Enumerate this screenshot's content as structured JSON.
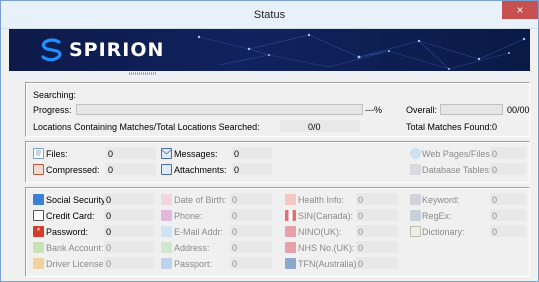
{
  "window": {
    "title": "Status",
    "close_glyph": "×"
  },
  "brand": {
    "name": "SPIRION"
  },
  "progress_panel": {
    "searching_label": "Searching:",
    "progress_label": "Progress:",
    "progress_suffix": "---%",
    "overall_label": "Overall:",
    "overall_value": "00/00",
    "locations_label": "Locations Containing Matches/Total Locations Searched:",
    "locations_value": "0/0",
    "total_matches_label": "Total Matches Found:",
    "total_matches_value": "0"
  },
  "counts_panel": {
    "files": {
      "label": "Files:",
      "value": "0",
      "icon": "file-icon"
    },
    "messages": {
      "label": "Messages:",
      "value": "0",
      "icon": "envelope-icon"
    },
    "web_pages": {
      "label": "Web Pages/Files:",
      "value": "0",
      "icon": "globe-icon"
    },
    "compressed": {
      "label": "Compressed:",
      "value": "0",
      "icon": "archive-icon"
    },
    "attachments": {
      "label": "Attachments:",
      "value": "0",
      "icon": "attachment-icon"
    },
    "database_tables": {
      "label": "Database Tables:",
      "value": "0",
      "icon": "database-icon"
    }
  },
  "types_panel": {
    "col1": [
      {
        "label": "Social Security:",
        "value": "0",
        "icon": "id-card-icon"
      },
      {
        "label": "Credit Card:",
        "value": "0",
        "icon": "credit-card-icon"
      },
      {
        "label": "Password:",
        "value": "0",
        "icon": "password-icon"
      },
      {
        "label": "Bank Account:",
        "value": "0",
        "icon": "bank-icon"
      },
      {
        "label": "Driver License:",
        "value": "0",
        "icon": "license-icon"
      }
    ],
    "col2": [
      {
        "label": "Date of Birth:",
        "value": "0",
        "icon": "calendar-icon"
      },
      {
        "label": "Phone:",
        "value": "0",
        "icon": "phone-icon"
      },
      {
        "label": "E-Mail Addr:",
        "value": "0",
        "icon": "email-icon"
      },
      {
        "label": "Address:",
        "value": "0",
        "icon": "address-icon"
      },
      {
        "label": "Passport:",
        "value": "0",
        "icon": "passport-icon"
      }
    ],
    "col3": [
      {
        "label": "Health Info:",
        "value": "0",
        "icon": "health-icon"
      },
      {
        "label": "SIN(Canada):",
        "value": "0",
        "icon": "canada-flag-icon"
      },
      {
        "label": "NINO(UK):",
        "value": "0",
        "icon": "uk-flag-icon"
      },
      {
        "label": "NHS No.(UK):",
        "value": "0",
        "icon": "uk-flag-icon"
      },
      {
        "label": "TFN(Australia):",
        "value": "0",
        "icon": "australia-flag-icon"
      }
    ],
    "col4": [
      {
        "label": "Keyword:",
        "value": "0",
        "icon": "keyword-icon"
      },
      {
        "label": "RegEx:",
        "value": "0",
        "icon": "regex-icon"
      },
      {
        "label": "Dictionary:",
        "value": "0",
        "icon": "dictionary-icon"
      }
    ]
  },
  "colors": {
    "brand_navy": "#0d1a4a",
    "brand_blue": "#1e90ff",
    "close_red": "#c75050"
  }
}
